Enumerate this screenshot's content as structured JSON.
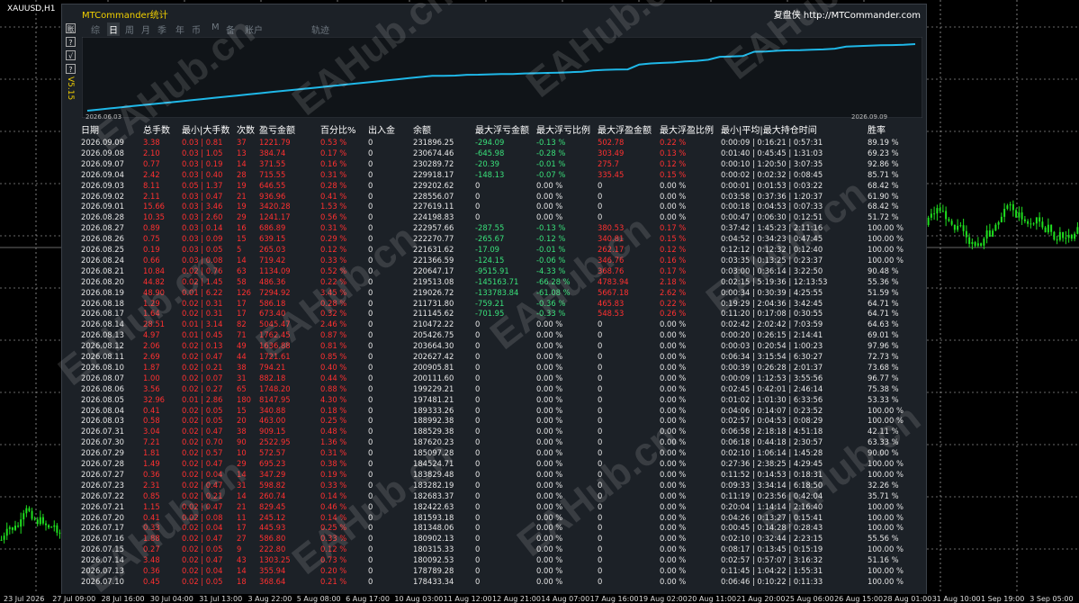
{
  "symbol_label": "XAUUSD,H1",
  "panel": {
    "title": "MTCommander统计",
    "brand": "复盘侠 http://MTCommander.com"
  },
  "side_buttons": [
    "账",
    "?",
    "√",
    "?"
  ],
  "version": "V5.15",
  "tabs": [
    {
      "label": "综",
      "active": false
    },
    {
      "label": "日",
      "active": true
    },
    {
      "label": "周",
      "active": false
    },
    {
      "label": "月",
      "active": false
    },
    {
      "label": "季",
      "active": false
    },
    {
      "label": "年",
      "active": false
    },
    {
      "label": "币",
      "active": false
    },
    {
      "label": "M",
      "active": false
    },
    {
      "label": "备",
      "active": false
    },
    {
      "label": "账户",
      "active": false
    },
    {
      "label": "轨迹",
      "active": false
    }
  ],
  "equity_chart": {
    "start_label": "2026.06.03",
    "end_label": "2026.09.09",
    "line_color": "#1fb8e8"
  },
  "headers": [
    "日期",
    "总手数",
    "最小|大手数",
    "次数",
    "盈亏金额",
    "百分比%",
    "出入金",
    "余额",
    "最大浮亏金额",
    "最大浮亏比例",
    "最大浮盈金额",
    "最大浮盈比例",
    "最小|平均|最大持仓时间",
    "胜率"
  ],
  "rows": [
    [
      "2026.09.09",
      "3.38",
      "0.03 | 0.81",
      "37",
      "1221.79",
      "0.53 %",
      "0",
      "231896.25",
      "-294.09",
      "-0.13 %",
      "502.78",
      "0.22 %",
      "0:00:09 | 0:16:21 | 0:57:31",
      "89.19 %"
    ],
    [
      "2026.09.08",
      "2.10",
      "0.03 | 1.05",
      "13",
      "384.74",
      "0.17 %",
      "0",
      "230674.46",
      "-645.98",
      "-0.28 %",
      "303.49",
      "0.13 %",
      "0:01:40 | 0:45:45 | 1:31:03",
      "69.23 %"
    ],
    [
      "2026.09.07",
      "0.77",
      "0.03 | 0.19",
      "14",
      "371.55",
      "0.16 %",
      "0",
      "230289.72",
      "-20.39",
      "-0.01 %",
      "275.7",
      "0.12 %",
      "0:00:10 | 1:20:50 | 3:07:35",
      "92.86 %"
    ],
    [
      "2026.09.04",
      "2.42",
      "0.03 | 0.40",
      "28",
      "715.55",
      "0.31 %",
      "0",
      "229918.17",
      "-148.13",
      "-0.07 %",
      "335.45",
      "0.15 %",
      "0:00:02 | 0:02:32 | 0:08:45",
      "85.71 %"
    ],
    [
      "2026.09.03",
      "8.11",
      "0.05 | 1.37",
      "19",
      "646.55",
      "0.28 %",
      "0",
      "229202.62",
      "0",
      "0.00 %",
      "0",
      "0.00 %",
      "0:00:01 | 0:01:53 | 0:03:22",
      "68.42 %"
    ],
    [
      "2026.09.02",
      "2.11",
      "0.03 | 0.47",
      "21",
      "936.96",
      "0.41 %",
      "0",
      "228556.07",
      "0",
      "0.00 %",
      "0",
      "0.00 %",
      "0:03:58 | 0:37:36 | 1:20:37",
      "61.90 %"
    ],
    [
      "2026.09.01",
      "15.66",
      "0.03 | 3.46",
      "19",
      "3420.28",
      "1.53 %",
      "0",
      "227619.11",
      "0",
      "0.00 %",
      "0",
      "0.00 %",
      "0:00:18 | 0:04:53 | 0:07:33",
      "68.42 %"
    ],
    [
      "2026.08.28",
      "10.35",
      "0.03 | 2.60",
      "29",
      "1241.17",
      "0.56 %",
      "0",
      "224198.83",
      "0",
      "0.00 %",
      "0",
      "0.00 %",
      "0:00:47 | 0:06:30 | 0:12:51",
      "51.72 %"
    ],
    [
      "2026.08.27",
      "0.89",
      "0.03 | 0.14",
      "16",
      "686.89",
      "0.31 %",
      "0",
      "222957.66",
      "-287.55",
      "-0.13 %",
      "380.53",
      "0.17 %",
      "0:37:42 | 1:45:23 | 2:11:16",
      "100.00 %"
    ],
    [
      "2026.08.26",
      "0.75",
      "0.03 | 0.09",
      "15",
      "639.15",
      "0.29 %",
      "0",
      "222270.77",
      "-265.67",
      "-0.12 %",
      "340.81",
      "0.15 %",
      "0:04:52 | 0:34:23 | 0:47:45",
      "100.00 %"
    ],
    [
      "2026.08.25",
      "0.19",
      "0.03 | 0.05",
      "5",
      "265.03",
      "0.12 %",
      "0",
      "221631.62",
      "-17.09",
      "-0.01 %",
      "262.17",
      "0.12 %",
      "0:12:12 | 0:12:32 | 0:12:40",
      "100.00 %"
    ],
    [
      "2026.08.24",
      "0.66",
      "0.03 | 0.08",
      "14",
      "719.42",
      "0.33 %",
      "0",
      "221366.59",
      "-124.15",
      "-0.06 %",
      "346.76",
      "0.16 %",
      "0:03:35 | 0:13:25 | 0:23:37",
      "100.00 %"
    ],
    [
      "2026.08.21",
      "10.84",
      "0.02 | 0.76",
      "63",
      "1134.09",
      "0.52 %",
      "0",
      "220647.17",
      "-9515.91",
      "-4.33 %",
      "368.76",
      "0.17 %",
      "0:03:00 | 0:36:14 | 3:22:50",
      "90.48 %"
    ],
    [
      "2026.08.20",
      "44.82",
      "0.02 | 1.45",
      "58",
      "486.36",
      "0.22 %",
      "0",
      "219513.08",
      "-145163.71",
      "-66.28 %",
      "4783.94",
      "2.18 %",
      "0:02:15 | 5:19:36 | 12:13:53",
      "55.36 %"
    ],
    [
      "2026.08.19",
      "48.90",
      "0.01 | 6.22",
      "126",
      "7294.92",
      "3.45 %",
      "0",
      "219026.72",
      "-133783.84",
      "-61.08 %",
      "5667.18",
      "2.62 %",
      "0:00:34 | 0:30:39 | 4:25:55",
      "51.59 %"
    ],
    [
      "2026.08.18",
      "1.29",
      "0.02 | 0.31",
      "17",
      "586.18",
      "0.28 %",
      "0",
      "211731.80",
      "-759.21",
      "-0.36 %",
      "465.83",
      "0.22 %",
      "0:19:29 | 2:04:36 | 3:42:45",
      "64.71 %"
    ],
    [
      "2026.08.17",
      "1.64",
      "0.02 | 0.31",
      "17",
      "673.40",
      "0.32 %",
      "0",
      "211145.62",
      "-701.95",
      "-0.33 %",
      "548.53",
      "0.26 %",
      "0:11:20 | 0:17:08 | 0:30:55",
      "64.71 %"
    ],
    [
      "2026.08.14",
      "28.51",
      "0.01 | 3.14",
      "82",
      "5045.47",
      "2.46 %",
      "0",
      "210472.22",
      "0",
      "0.00 %",
      "0",
      "0.00 %",
      "0:02:42 | 2:02:42 | 7:03:59",
      "64.63 %"
    ],
    [
      "2026.08.13",
      "4.97",
      "0.01 | 0.45",
      "71",
      "1762.45",
      "0.87 %",
      "0",
      "205426.75",
      "0",
      "0.00 %",
      "0",
      "0.00 %",
      "0:00:20 | 0:26:15 | 2:14:41",
      "69.01 %"
    ],
    [
      "2026.08.12",
      "2.06",
      "0.02 | 0.13",
      "49",
      "1636.88",
      "0.81 %",
      "0",
      "203664.30",
      "0",
      "0.00 %",
      "0",
      "0.00 %",
      "0:00:03 | 0:20:54 | 1:00:23",
      "97.96 %"
    ],
    [
      "2026.08.11",
      "2.69",
      "0.02 | 0.47",
      "44",
      "1721.61",
      "0.85 %",
      "0",
      "202627.42",
      "0",
      "0.00 %",
      "0",
      "0.00 %",
      "0:06:34 | 3:15:54 | 6:30:27",
      "72.73 %"
    ],
    [
      "2026.08.10",
      "1.87",
      "0.02 | 0.21",
      "38",
      "794.21",
      "0.40 %",
      "0",
      "200905.81",
      "0",
      "0.00 %",
      "0",
      "0.00 %",
      "0:00:39 | 0:26:28 | 2:01:37",
      "73.68 %"
    ],
    [
      "2026.08.07",
      "1.00",
      "0.02 | 0.07",
      "31",
      "882.18",
      "0.44 %",
      "0",
      "200111.60",
      "0",
      "0.00 %",
      "0",
      "0.00 %",
      "0:00:09 | 1:12:53 | 3:55:56",
      "96.77 %"
    ],
    [
      "2026.08.06",
      "3.56",
      "0.02 | 0.27",
      "65",
      "1748.20",
      "0.88 %",
      "0",
      "199229.21",
      "0",
      "0.00 %",
      "0",
      "0.00 %",
      "0:02:45 | 0:42:01 | 2:46:14",
      "75.38 %"
    ],
    [
      "2026.08.05",
      "32.96",
      "0.01 | 2.86",
      "180",
      "8147.95",
      "4.30 %",
      "0",
      "197481.21",
      "0",
      "0.00 %",
      "0",
      "0.00 %",
      "0:01:02 | 1:01:30 | 6:33:56",
      "53.33 %"
    ],
    [
      "2026.08.04",
      "0.41",
      "0.02 | 0.05",
      "15",
      "340.88",
      "0.18 %",
      "0",
      "189333.26",
      "0",
      "0.00 %",
      "0",
      "0.00 %",
      "0:04:06 | 0:14:07 | 0:23:52",
      "100.00 %"
    ],
    [
      "2026.08.03",
      "0.58",
      "0.02 | 0.05",
      "20",
      "463.00",
      "0.25 %",
      "0",
      "188992.38",
      "0",
      "0.00 %",
      "0",
      "0.00 %",
      "0:02:57 | 0:04:53 | 0:08:29",
      "100.00 %"
    ],
    [
      "2026.07.31",
      "3.04",
      "0.02 | 0.47",
      "38",
      "909.15",
      "0.48 %",
      "0",
      "188529.38",
      "0",
      "0.00 %",
      "0",
      "0.00 %",
      "0:06:58 | 2:18:18 | 4:51:18",
      "42.11 %"
    ],
    [
      "2026.07.30",
      "7.21",
      "0.02 | 0.70",
      "90",
      "2522.95",
      "1.36 %",
      "0",
      "187620.23",
      "0",
      "0.00 %",
      "0",
      "0.00 %",
      "0:06:18 | 0:44:18 | 2:30:57",
      "63.33 %"
    ],
    [
      "2026.07.29",
      "1.81",
      "0.02 | 0.57",
      "10",
      "572.57",
      "0.31 %",
      "0",
      "185097.28",
      "0",
      "0.00 %",
      "0",
      "0.00 %",
      "0:02:10 | 1:06:14 | 1:45:28",
      "90.00 %"
    ],
    [
      "2026.07.28",
      "1.49",
      "0.02 | 0.47",
      "29",
      "695.23",
      "0.38 %",
      "0",
      "184524.71",
      "0",
      "0.00 %",
      "0",
      "0.00 %",
      "0:27:36 | 2:38:25 | 4:29:45",
      "100.00 %"
    ],
    [
      "2026.07.27",
      "0.36",
      "0.02 | 0.04",
      "14",
      "347.29",
      "0.19 %",
      "0",
      "183829.48",
      "0",
      "0.00 %",
      "0",
      "0.00 %",
      "0:11:52 | 0:14:53 | 0:18:31",
      "100.00 %"
    ],
    [
      "2026.07.23",
      "2.31",
      "0.02 | 0.47",
      "31",
      "598.82",
      "0.33 %",
      "0",
      "183282.19",
      "0",
      "0.00 %",
      "0",
      "0.00 %",
      "0:09:33 | 3:34:14 | 6:18:50",
      "32.26 %"
    ],
    [
      "2026.07.22",
      "0.85",
      "0.02 | 0.21",
      "14",
      "260.74",
      "0.14 %",
      "0",
      "182683.37",
      "0",
      "0.00 %",
      "0",
      "0.00 %",
      "0:11:19 | 0:23:56 | 0:42:04",
      "35.71 %"
    ],
    [
      "2026.07.21",
      "1.15",
      "0.02 | 0.47",
      "21",
      "829.45",
      "0.46 %",
      "0",
      "182422.63",
      "0",
      "0.00 %",
      "0",
      "0.00 %",
      "0:20:04 | 1:14:14 | 2:16:40",
      "100.00 %"
    ],
    [
      "2026.07.20",
      "0.41",
      "0.02 | 0.08",
      "11",
      "245.12",
      "0.14 %",
      "0",
      "181593.18",
      "0",
      "0.00 %",
      "0",
      "0.00 %",
      "0:04:26 | 0:13:27 | 0:15:41",
      "100.00 %"
    ],
    [
      "2026.07.17",
      "0.33",
      "0.02 | 0.04",
      "17",
      "445.93",
      "0.25 %",
      "0",
      "181348.06",
      "0",
      "0.00 %",
      "0",
      "0.00 %",
      "0:00:45 | 0:14:28 | 0:28:43",
      "100.00 %"
    ],
    [
      "2026.07.16",
      "1.88",
      "0.02 | 0.47",
      "27",
      "586.80",
      "0.33 %",
      "0",
      "180902.13",
      "0",
      "0.00 %",
      "0",
      "0.00 %",
      "0:02:10 | 0:32:44 | 2:23:15",
      "55.56 %"
    ],
    [
      "2026.07.15",
      "0.27",
      "0.02 | 0.05",
      "9",
      "222.80",
      "0.12 %",
      "0",
      "180315.33",
      "0",
      "0.00 %",
      "0",
      "0.00 %",
      "0:08:17 | 0:13:45 | 0:15:19",
      "100.00 %"
    ],
    [
      "2026.07.14",
      "3.48",
      "0.02 | 0.47",
      "43",
      "1303.25",
      "0.73 %",
      "0",
      "180092.53",
      "0",
      "0.00 %",
      "0",
      "0.00 %",
      "0:02:57 | 0:57:07 | 3:16:32",
      "51.16 %"
    ],
    [
      "2026.07.13",
      "0.36",
      "0.02 | 0.04",
      "14",
      "355.94",
      "0.20 %",
      "0",
      "178789.28",
      "0",
      "0.00 %",
      "0",
      "0.00 %",
      "0:11:45 | 1:04:22 | 1:55:31",
      "100.00 %"
    ],
    [
      "2026.07.10",
      "0.45",
      "0.02 | 0.05",
      "18",
      "368.64",
      "0.21 %",
      "0",
      "178433.34",
      "0",
      "0.00 %",
      "0",
      "0.00 %",
      "0:06:46 | 0:10:22 | 0:11:33",
      "100.00 %"
    ]
  ],
  "time_axis": [
    "23 Jul 2026",
    "27 Jul 09:00",
    "28 Jul 16:00",
    "30 Jul 04:00",
    "31 Jul 13:00",
    "3 Aug 22:00",
    "5 Aug 08:00",
    "6 Aug 17:00",
    "10 Aug 03:00",
    "11 Aug 12:00",
    "12 Aug 21:00",
    "14 Aug 07:00",
    "17 Aug 16:00",
    "19 Aug 02:00",
    "20 Aug 11:00",
    "21 Aug 20:00",
    "25 Aug 06:00",
    "26 Aug 15:00",
    "28 Aug 01:00",
    "31 Aug 10:00",
    "1 Sep 19:00",
    "3 Sep 05:00"
  ],
  "watermark": "EAHub.cn"
}
